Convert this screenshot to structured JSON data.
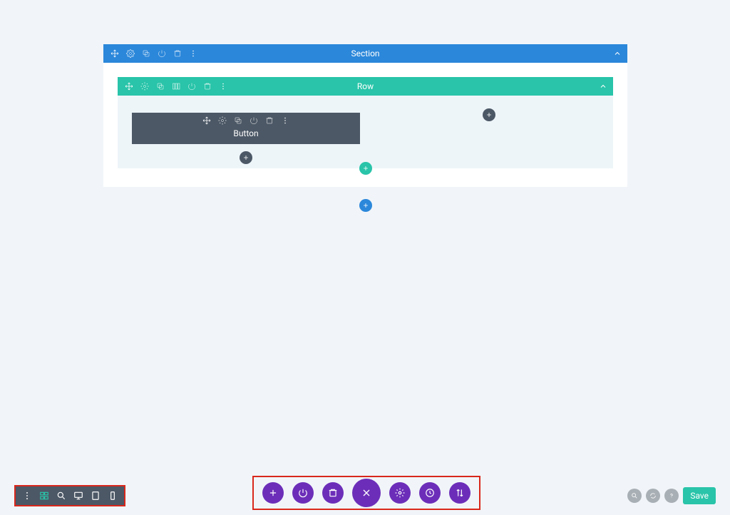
{
  "section": {
    "title": "Section"
  },
  "row": {
    "title": "Row"
  },
  "module": {
    "label": "Button"
  },
  "bottom_right": {
    "save_label": "Save"
  }
}
